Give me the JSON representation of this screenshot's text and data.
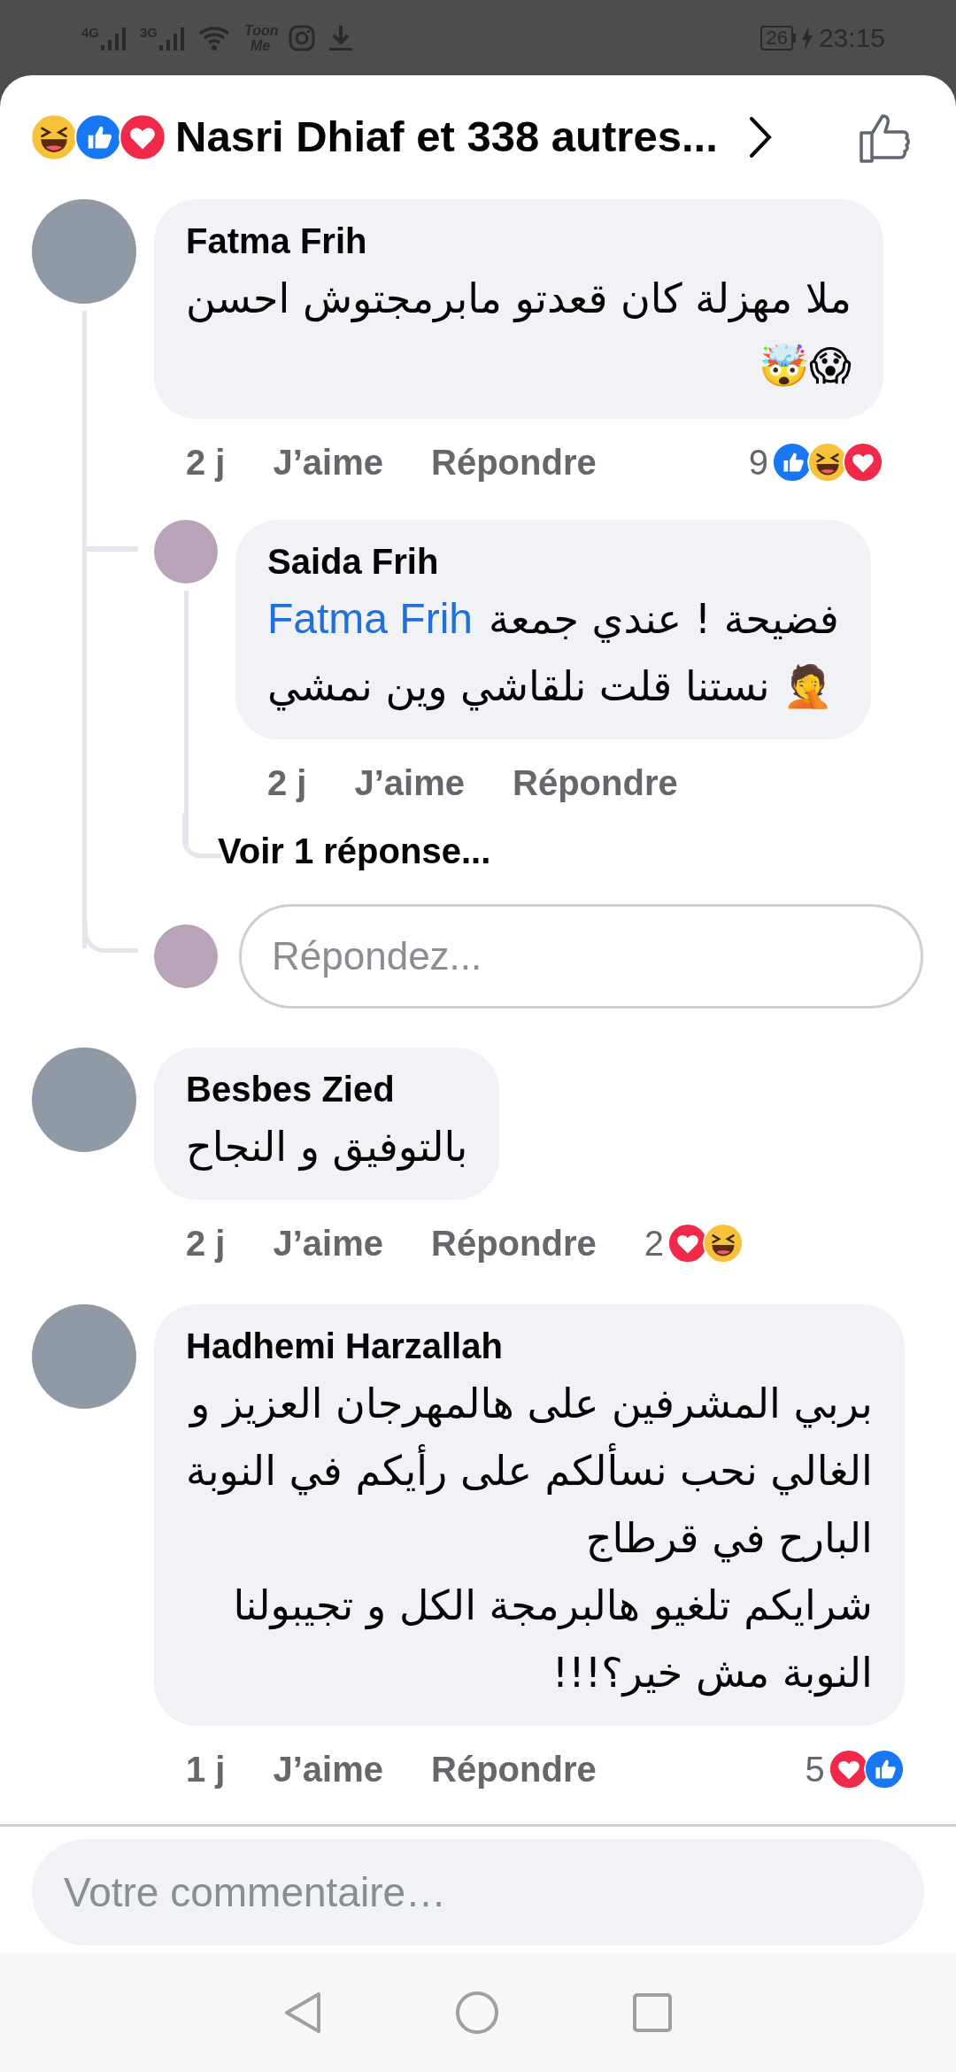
{
  "status_bar": {
    "network_labels": [
      "4G",
      "3G"
    ],
    "app_label": "Toon Me",
    "battery": "26",
    "time": "23:15"
  },
  "header": {
    "reactions": [
      {
        "kind": "haha"
      },
      {
        "kind": "like"
      },
      {
        "kind": "love"
      }
    ],
    "title": "Nasri Dhiaf et 338 autres..."
  },
  "comments": [
    {
      "author": "Fatma Frih",
      "lines": [
        "ملا مهزلة كان قعدتو مابرمجتوش احسن",
        "😱🤯"
      ],
      "time": "2 j",
      "like_label": "J’aime",
      "reply_label": "Répondre",
      "reaction_count": "9",
      "reactions": [
        {
          "kind": "like"
        },
        {
          "kind": "haha"
        },
        {
          "kind": "love"
        }
      ],
      "children": [
        {
          "author": "Saida Frih",
          "mention": "Fatma Frih",
          "lines": [
            "فضيحة ! عندي جمعة",
            "🤦 نستنا قلت نلقاشي وين نمشي"
          ],
          "time": "2 j",
          "like_label": "J’aime",
          "reply_label": "Répondre",
          "more_replies": "Voir 1 réponse..."
        }
      ],
      "reply_field": {
        "placeholder": "Répondez..."
      }
    },
    {
      "author": "Besbes Zied",
      "lines": [
        "بالتوفيق و النجاح"
      ],
      "time": "2 j",
      "like_label": "J’aime",
      "reply_label": "Répondre",
      "reaction_count": "2",
      "reactions": [
        {
          "kind": "love"
        },
        {
          "kind": "haha"
        }
      ]
    },
    {
      "author": "Hadhemi Harzallah",
      "lines": [
        "بربي المشرفين على هالمهرجان العزيز و",
        "الغالي نحب نسألكم على رأيكم في النوبة",
        "البارح في قرطاج",
        "شرايكم تلغيو هالبرمجة الكل و تجيبولنا",
        "النوبة مش خير؟!!!"
      ],
      "time": "1 j",
      "like_label": "J’aime",
      "reply_label": "Répondre",
      "reaction_count": "5",
      "reactions": [
        {
          "kind": "love"
        },
        {
          "kind": "like"
        }
      ]
    }
  ],
  "comment_field": {
    "placeholder": "Votre commentaire…"
  }
}
